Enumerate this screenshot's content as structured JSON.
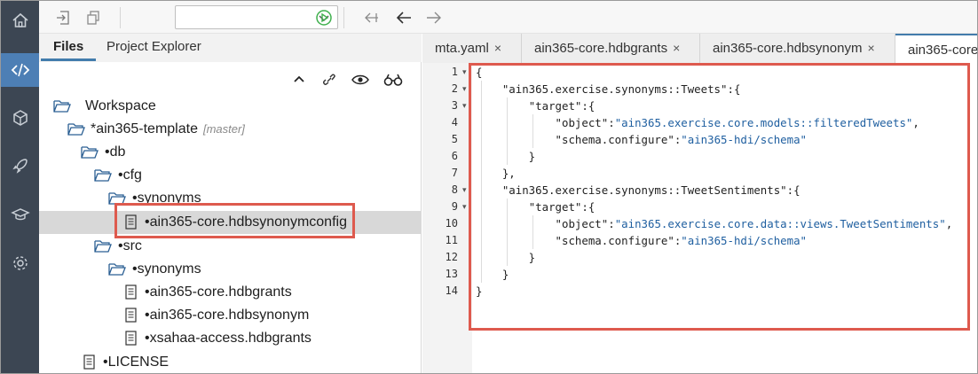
{
  "toolbar": {
    "icons": [
      "import-icon",
      "export-icon",
      "run-icon",
      "back-icon",
      "arrow-left-icon",
      "arrow-right-icon"
    ],
    "run_config_value": ""
  },
  "activity_bar": [
    "home-icon",
    "code-icon",
    "cube-icon",
    "rocket-icon",
    "graduation-cap-icon",
    "settings-icon"
  ],
  "files_panel": {
    "tabs": [
      "Files",
      "Project Explorer"
    ],
    "active_tab": "Files",
    "actions": [
      "collapse-icon",
      "link-icon",
      "eye-icon",
      "binoculars-icon"
    ],
    "tree": [
      {
        "label": "Workspace",
        "type": "folder",
        "level": 0
      },
      {
        "label": "*ain365-template",
        "branch": "[master]",
        "type": "folder",
        "level": 1
      },
      {
        "label": "•db",
        "type": "folder",
        "level": 2
      },
      {
        "label": "•cfg",
        "type": "folder",
        "level": 3
      },
      {
        "label": "•synonyms",
        "type": "folder",
        "level": 4
      },
      {
        "label": "•ain365-core.hdbsynonymconfig",
        "type": "file",
        "level": 5,
        "selected": true
      },
      {
        "label": "•src",
        "type": "folder",
        "level": 3
      },
      {
        "label": "•synonyms",
        "type": "folder",
        "level": 4
      },
      {
        "label": "•ain365-core.hdbgrants",
        "type": "file",
        "level": 5
      },
      {
        "label": "•ain365-core.hdbsynonym",
        "type": "file",
        "level": 5
      },
      {
        "label": "•xsahaa-access.hdbgrants",
        "type": "file",
        "level": 5
      },
      {
        "label": "•LICENSE",
        "type": "file",
        "level": 2
      }
    ]
  },
  "editor": {
    "tabs": [
      {
        "label": "mta.yaml",
        "close": "×"
      },
      {
        "label": "ain365-core.hdbgrants",
        "close": "×"
      },
      {
        "label": "ain365-core.hdbsynonym",
        "close": "×"
      },
      {
        "label": "ain365-core",
        "close": "",
        "active": true
      }
    ],
    "lines": [
      {
        "n": "1",
        "text": "{",
        "fold": true
      },
      {
        "n": "2",
        "text": "    \"ain365.exercise.synonyms::Tweets\":{",
        "fold": true
      },
      {
        "n": "3",
        "text": "        \"target\":{",
        "fold": true
      },
      {
        "n": "4",
        "text": "            \"object\":\"ain365.exercise.core.models::filteredTweets\","
      },
      {
        "n": "5",
        "text": "            \"schema.configure\":\"ain365-hdi/schema\""
      },
      {
        "n": "6",
        "text": "        }"
      },
      {
        "n": "7",
        "text": "    },"
      },
      {
        "n": "8",
        "text": "    \"ain365.exercise.synonyms::TweetSentiments\":{",
        "fold": true
      },
      {
        "n": "9",
        "text": "        \"target\":{",
        "fold": true
      },
      {
        "n": "10",
        "text": "            \"object\":\"ain365.exercise.core.data::views.TweetSentiments\","
      },
      {
        "n": "11",
        "text": "            \"schema.configure\":\"ain365-hdi/schema\""
      },
      {
        "n": "12",
        "text": "        }"
      },
      {
        "n": "13",
        "text": "    }"
      },
      {
        "n": "14",
        "text": "}"
      }
    ]
  },
  "colors": {
    "accent": "#427cac",
    "highlight": "#de5a4e",
    "activity_bg": "#3c4653",
    "active_activity": "#4d7fb5",
    "string": "#1f5fa0"
  }
}
